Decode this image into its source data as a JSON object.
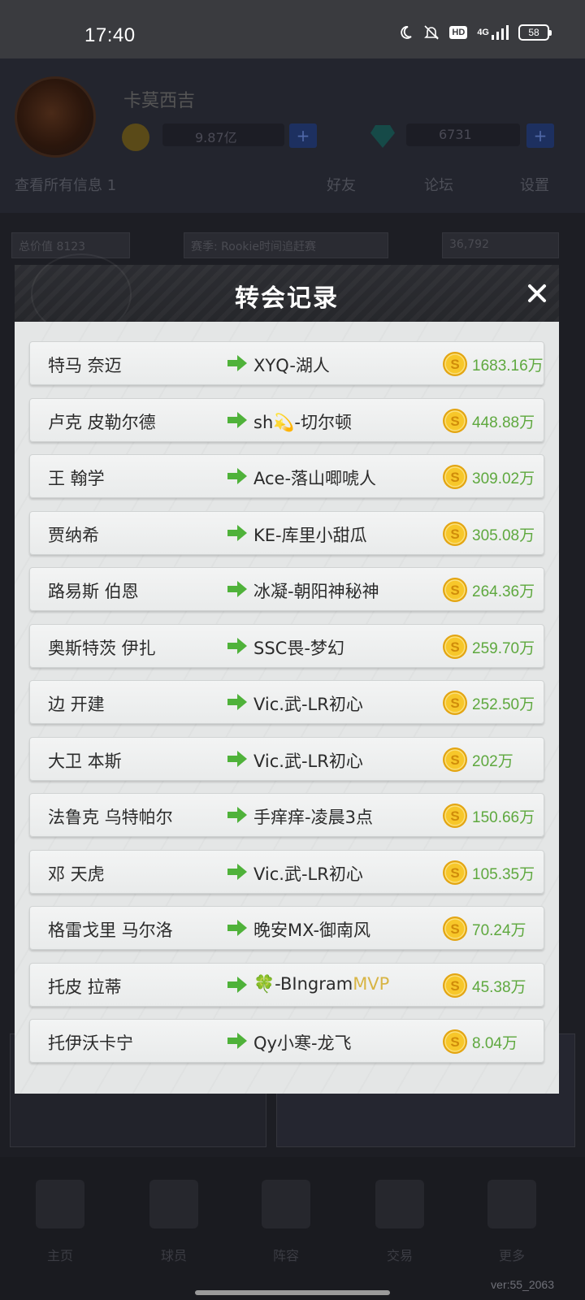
{
  "status_bar": {
    "time": "17:40",
    "hd_label": "HD",
    "network_label": "4G",
    "battery": "58"
  },
  "background": {
    "user_name": "卡莫西吉",
    "coins": "9.87亿",
    "gems": "6731",
    "plus": "+",
    "toolbar": {
      "left": "查看所有信息 1",
      "a": "好友",
      "b": "论坛",
      "c": "设置"
    },
    "bar": {
      "left": "总价值 8123",
      "middle": "赛季: Rookie时间追赶赛",
      "right": "36,792"
    },
    "tabs": [
      "主页",
      "球员",
      "阵容",
      "交易",
      "更多"
    ],
    "version": "ver:55_2063"
  },
  "modal": {
    "title": "转会记录",
    "records": [
      {
        "player": "特马 奈迈",
        "team": "XYQ-湖人",
        "team_extra": "",
        "amount": "1683.16万"
      },
      {
        "player": "卢克 皮勒尔德",
        "team": "sh💫-切尔顿",
        "team_extra": "",
        "amount": "448.88万"
      },
      {
        "player": "王 翰学",
        "team": "Ace-落山唧唬人",
        "team_extra": "",
        "amount": "309.02万"
      },
      {
        "player": "贾纳希",
        "team": "KE-库里小甜瓜",
        "team_extra": "",
        "amount": "305.08万"
      },
      {
        "player": "路易斯 伯恩",
        "team": "冰凝-朝阳神秘神",
        "team_extra": "",
        "amount": "264.36万"
      },
      {
        "player": "奥斯特茨 伊扎",
        "team": "SSC畏-梦幻",
        "team_extra": "",
        "amount": "259.70万"
      },
      {
        "player": "边 开建",
        "team": "Vic.武-LR初心",
        "team_extra": "",
        "amount": "252.50万"
      },
      {
        "player": "大卫 本斯",
        "team": "Vic.武-LR初心",
        "team_extra": "",
        "amount": "202万"
      },
      {
        "player": "法鲁克 乌特帕尔",
        "team": "手痒痒-凌晨3点",
        "team_extra": "",
        "amount": "150.66万"
      },
      {
        "player": "邓 天虎",
        "team": "Vic.武-LR初心",
        "team_extra": "",
        "amount": "105.35万"
      },
      {
        "player": "格雷戈里 马尔洛",
        "team": "晚安MX-御南风",
        "team_extra": "",
        "amount": "70.24万"
      },
      {
        "player": "托皮 拉蒂",
        "team": "🍀-BIngram",
        "team_extra": "MVP",
        "amount": "45.38万"
      },
      {
        "player": "托伊沃卡宁",
        "team": "Qy小寒-龙飞",
        "team_extra": "",
        "amount": "8.04万"
      }
    ]
  },
  "colors": {
    "amount_green": "#5ea83e",
    "arrow_green": "#4fb23a",
    "coin_gold": "#f0b81c",
    "mvp_gold": "#d8b545",
    "header_dark": "#2a2b30",
    "body_light": "#e4e6e6"
  },
  "icons": {
    "arrow": "arrow-right-icon",
    "coin": "coin-icon",
    "close": "close-icon"
  }
}
